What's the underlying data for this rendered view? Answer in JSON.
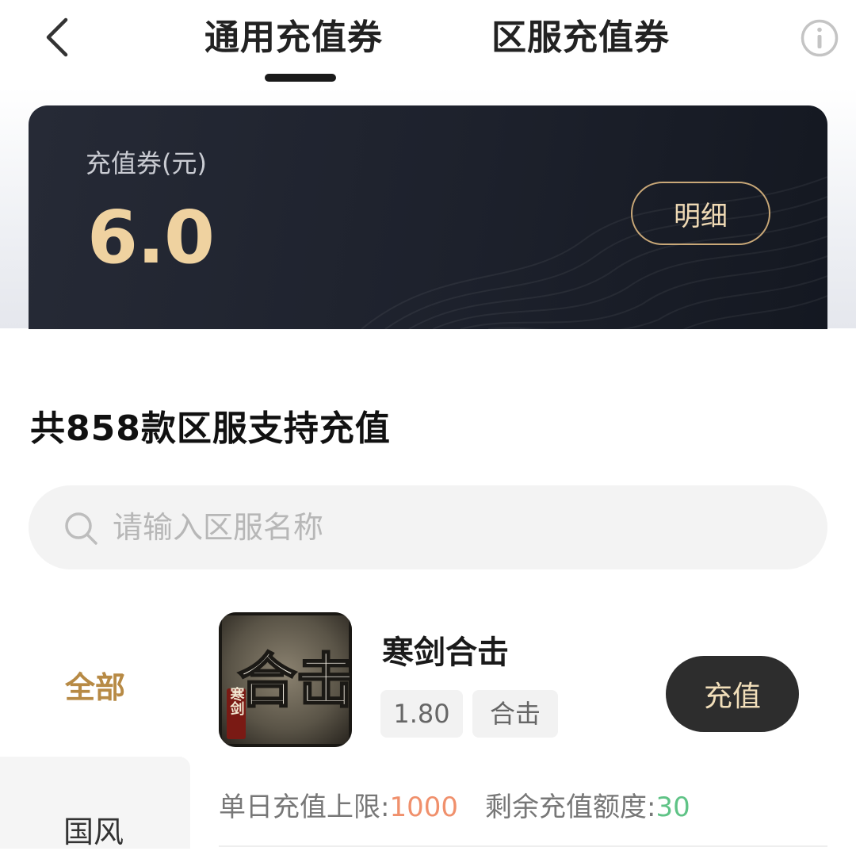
{
  "nav": {
    "tabs": [
      {
        "label": "通用充值券",
        "active": true
      },
      {
        "label": "区服充值券",
        "active": false
      }
    ],
    "back_icon": "chevron-left-icon",
    "info_icon": "info-icon"
  },
  "balance": {
    "label": "充值券(元)",
    "amount": "6.0",
    "detail_button": "明细"
  },
  "servers": {
    "count_title": "共858款区服支持充值",
    "search_placeholder": "请输入区服名称"
  },
  "sidebar": {
    "items": [
      {
        "label": "全部",
        "active": true
      },
      {
        "label": "国风",
        "active": false
      }
    ]
  },
  "games": [
    {
      "name": "寒剑合击",
      "icon_text": "合击",
      "icon_small_text": "寒剑",
      "tags": [
        "1.80",
        "合击"
      ],
      "button": "充值",
      "daily_limit_label": "单日充值上限:",
      "daily_limit_value": "1000",
      "remaining_label": "剩余充值额度:",
      "remaining_value": "30"
    }
  ],
  "colors": {
    "accent_gold": "#b78a45",
    "amount_gold": "#efd2a0",
    "card_dark": "#1d212c",
    "limit_orange": "#f0906c",
    "remaining_green": "#5fc386"
  }
}
